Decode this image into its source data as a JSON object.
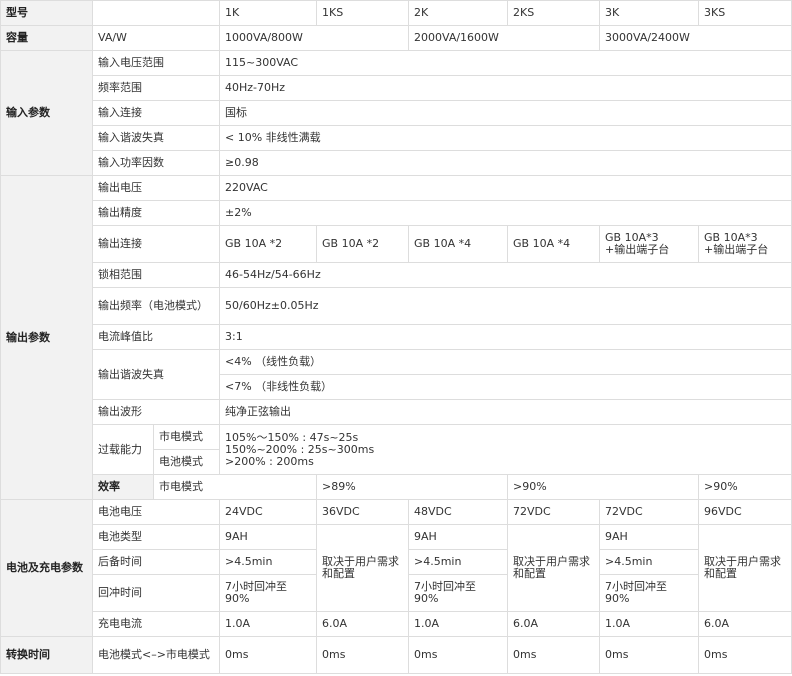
{
  "header": {
    "model_label": "型号",
    "models": [
      "1K",
      "1KS",
      "2K",
      "2KS",
      "3K",
      "3KS"
    ]
  },
  "capacity": {
    "label": "容量",
    "unit": "VA/W",
    "values": [
      "1000VA/800W",
      "2000VA/1600W",
      "3000VA/2400W"
    ]
  },
  "input": {
    "category": "输入参数",
    "rows": [
      {
        "label": "输入电压范围",
        "value": "115~300VAC"
      },
      {
        "label": "频率范围",
        "value": "40Hz-70Hz"
      },
      {
        "label": "输入连接",
        "value": "国标"
      },
      {
        "label": "输入谐波失真",
        "value": "< 10% 非线性满载"
      },
      {
        "label": "输入功率因数",
        "value": "≥0.98"
      }
    ]
  },
  "output": {
    "category": "输出参数",
    "voltage": {
      "label": "输出电压",
      "value": "220VAC"
    },
    "precision": {
      "label": "输出精度",
      "value": "±2%"
    },
    "connection": {
      "label": "输出连接",
      "values": [
        "GB 10A *2",
        "GB 10A *2",
        "GB 10A *4",
        "GB 10A *4",
        "GB 10A*3\n+输出端子台",
        "GB 10A*3\n+输出端子台"
      ]
    },
    "phase_lock": {
      "label": "锁相范围",
      "value": "46-54Hz/54-66Hz"
    },
    "frequency": {
      "label": "输出频率（电池模式）",
      "value": "50/60Hz±0.05Hz"
    },
    "crest": {
      "label": "电流峰值比",
      "value": "3:1"
    },
    "thd": {
      "label": "输出谐波失真",
      "linear": "<4% （线性负载）",
      "nonlinear": "<7% （非线性负载）"
    },
    "waveform": {
      "label": "输出波形",
      "value": "纯净正弦输出"
    },
    "overload": {
      "label": "过载能力",
      "mains_label": "市电模式",
      "battery_label": "电池模式",
      "value": "105%～150% : 47s~25s\n150%~200% : 25s~300ms\n>200% : 200ms"
    }
  },
  "efficiency": {
    "label": "效率",
    "mode": "市电模式",
    "values": [
      ">89%",
      ">90%",
      ">90%"
    ]
  },
  "battery": {
    "category": "电池及充电参数",
    "voltage": {
      "label": "电池电压",
      "values": [
        "24VDC",
        "36VDC",
        "48VDC",
        "72VDC",
        "72VDC",
        "96VDC"
      ]
    },
    "type": {
      "label": "电池类型",
      "value": "9AH"
    },
    "backup": {
      "label": "后备时间",
      "value": ">4.5min"
    },
    "recharge": {
      "label": "回冲时间",
      "value": "7小时回冲至\n90%"
    },
    "depends": "取决于用户需求\n和配置",
    "charge_current": {
      "label": "充电电流",
      "values": [
        "1.0A",
        "6.0A",
        "1.0A",
        "6.0A",
        "1.0A",
        "6.0A"
      ]
    }
  },
  "transfer": {
    "label": "转换时间",
    "mode": "电池模式<–>市电模式",
    "values": [
      "0ms",
      "0ms",
      "0ms",
      "0ms",
      "0ms",
      "0ms"
    ]
  }
}
